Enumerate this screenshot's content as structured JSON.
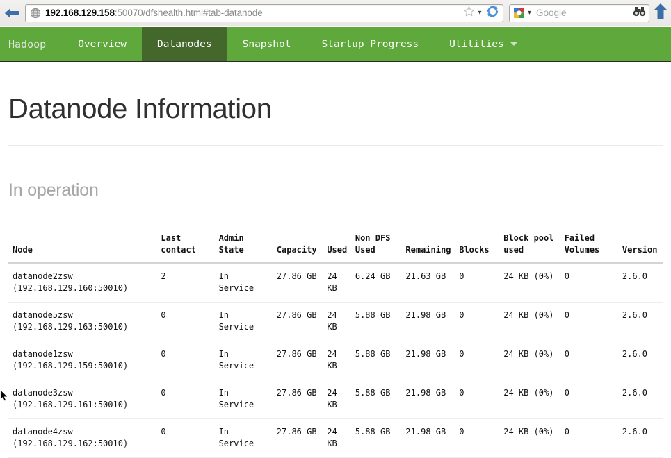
{
  "browser": {
    "back_icon": "back-arrow-icon",
    "url_host": "192.168.129.158",
    "url_rest": ":50070/dfshealth.html#tab-datanode",
    "star_icon": "star-icon",
    "star_chevron": "▾",
    "reload_icon": "reload-icon",
    "search_engine_icon": "google-logo-icon",
    "search_chevron": "▾",
    "search_placeholder": "Google",
    "binoculars_icon": "binoculars-icon",
    "home_icon": "home-arrow-icon"
  },
  "navbar": {
    "brand": "Hadoop",
    "items": [
      {
        "label": "Overview",
        "active": false
      },
      {
        "label": "Datanodes",
        "active": true
      },
      {
        "label": "Snapshot",
        "active": false
      },
      {
        "label": "Startup Progress",
        "active": false
      },
      {
        "label": "Utilities",
        "active": false,
        "caret": true
      }
    ],
    "bg_color": "#5fa83c",
    "active_bg_color": "#44682c"
  },
  "page": {
    "title": "Datanode Information",
    "subtitle": "In operation"
  },
  "table": {
    "headers": [
      "Node",
      "Last contact",
      "Admin State",
      "Capacity",
      "Used",
      "Non DFS Used",
      "Remaining",
      "Blocks",
      "Block pool used",
      "Failed Volumes",
      "Version"
    ],
    "rows": [
      {
        "node_name": "datanode2zsw",
        "node_addr": "(192.168.129.160:50010)",
        "last_contact": "2",
        "admin_state": "In Service",
        "capacity": "27.86 GB",
        "used": "24 KB",
        "non_dfs_used": "6.24 GB",
        "remaining": "21.63 GB",
        "blocks": "0",
        "block_pool_used": "24 KB (0%)",
        "failed_volumes": "0",
        "version": "2.6.0"
      },
      {
        "node_name": "datanode5zsw",
        "node_addr": "(192.168.129.163:50010)",
        "last_contact": "0",
        "admin_state": "In Service",
        "capacity": "27.86 GB",
        "used": "24 KB",
        "non_dfs_used": "5.88 GB",
        "remaining": "21.98 GB",
        "blocks": "0",
        "block_pool_used": "24 KB (0%)",
        "failed_volumes": "0",
        "version": "2.6.0"
      },
      {
        "node_name": "datanode1zsw",
        "node_addr": "(192.168.129.159:50010)",
        "last_contact": "0",
        "admin_state": "In Service",
        "capacity": "27.86 GB",
        "used": "24 KB",
        "non_dfs_used": "5.88 GB",
        "remaining": "21.98 GB",
        "blocks": "0",
        "block_pool_used": "24 KB (0%)",
        "failed_volumes": "0",
        "version": "2.6.0"
      },
      {
        "node_name": "datanode3zsw",
        "node_addr": "(192.168.129.161:50010)",
        "last_contact": "0",
        "admin_state": "In Service",
        "capacity": "27.86 GB",
        "used": "24 KB",
        "non_dfs_used": "5.88 GB",
        "remaining": "21.98 GB",
        "blocks": "0",
        "block_pool_used": "24 KB (0%)",
        "failed_volumes": "0",
        "version": "2.6.0"
      },
      {
        "node_name": "datanode4zsw",
        "node_addr": "(192.168.129.162:50010)",
        "last_contact": "0",
        "admin_state": "In Service",
        "capacity": "27.86 GB",
        "used": "24 KB",
        "non_dfs_used": "5.88 GB",
        "remaining": "21.98 GB",
        "blocks": "0",
        "block_pool_used": "24 KB (0%)",
        "failed_volumes": "0",
        "version": "2.6.0"
      }
    ]
  }
}
